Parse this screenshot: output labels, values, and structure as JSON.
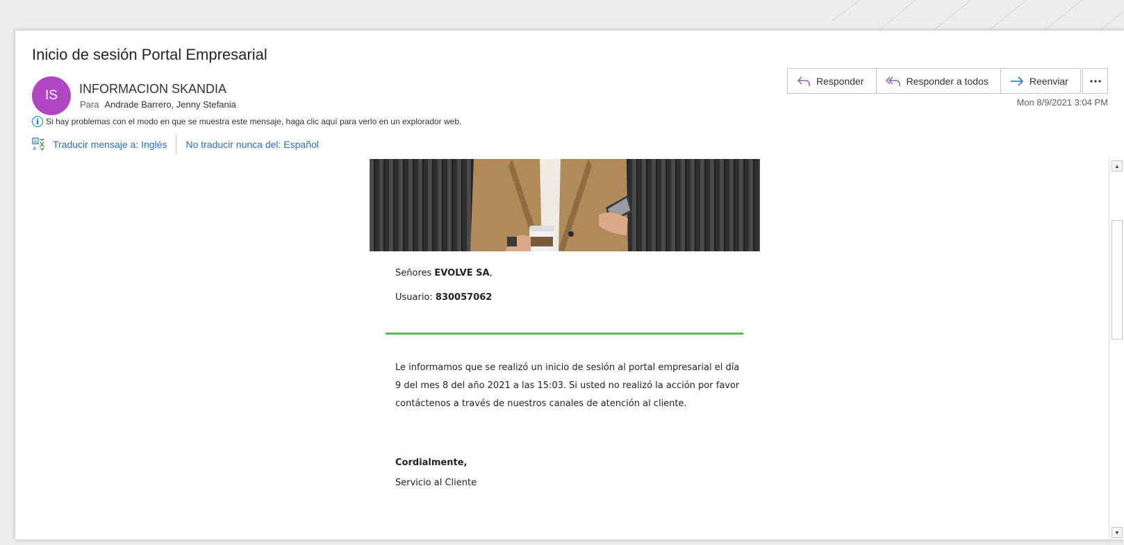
{
  "email": {
    "subject": "Inicio de sesión Portal Empresarial",
    "avatar_initials": "IS",
    "avatar_color": "#b146c2",
    "sender": "INFORMACION SKANDIA",
    "to_label": "Para",
    "to": "Andrade Barrero, Jenny Stefania",
    "date": "Mon 8/9/2021 3:04 PM",
    "info_text": "Si hay problemas con el modo en que se muestra este mensaje, haga clic aquí para verlo en un explorador web."
  },
  "actions": {
    "reply": "Responder",
    "reply_all": "Responder a todos",
    "forward": "Reenviar",
    "more": "···"
  },
  "translate": {
    "translate_link": "Traducir mensaje a: Inglés",
    "never_link": "No traducir nunca del: Español"
  },
  "body": {
    "greeting_prefix": "Señores ",
    "company": "EVOLVE SA",
    "greeting_suffix": ",",
    "user_label": "Usuario: ",
    "user_id": "830057062",
    "message": "Le informamos que se realizó un inicio de sesión al portal empresarial el día 9 del mes 8 del año 2021 a las 15:03. Si usted no realizó la acción por favor contáctenos a través de nuestros canales de atención al cliente.",
    "closing": "Cordialmente,",
    "signature": "Servicio al Cliente"
  },
  "colors": {
    "accent_blue": "#0078d4",
    "link": "#2a6ebd",
    "divider_green": "#5cb85c"
  }
}
